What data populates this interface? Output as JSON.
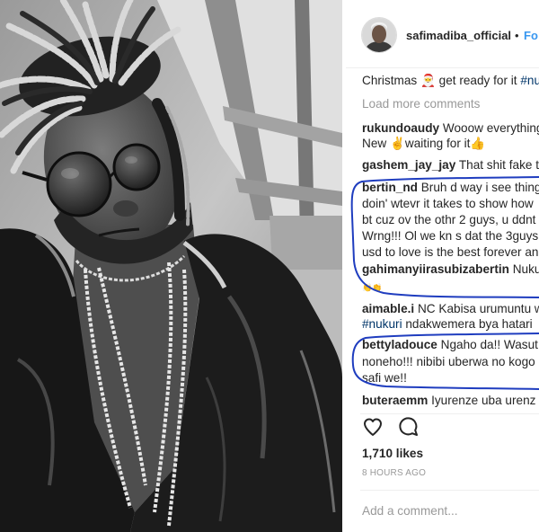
{
  "header": {
    "username": "safimadiba_official",
    "separator": "•",
    "follow_label": "Fo",
    "avatar_icon": "profile-avatar"
  },
  "caption": {
    "text": "Christmas 🎅 get ready for it ",
    "hashtag": "#nuku"
  },
  "load_more_label": "Load more comments",
  "comments": [
    {
      "username": "rukundoaudy",
      "lines": [
        "Wooow everything",
        "New ✌waiting for it👍"
      ]
    },
    {
      "username": "gashem_jay_jay",
      "lines": [
        "That shit fake th"
      ]
    },
    {
      "username": "bertin_nd",
      "lines": [
        "Bruh d way i see thing",
        "doin' wtevr it takes to show how",
        "bt cuz ov the othr 2 guys, u ddnt",
        "Wrng!!! Ol we kn s dat the 3guys",
        "usd to love is the best forever an"
      ]
    },
    {
      "username": "gahimanyiirasubizabertin",
      "lines": [
        "Nukuri",
        "👏👏"
      ]
    },
    {
      "username": "aimable.i",
      "lines": [
        "NC Kabisa urumuntu w",
        "#nukuri",
        " ndakwemera bya hatari"
      ]
    },
    {
      "username": "bettyladouce",
      "lines": [
        "Ngaho da!! Wasut",
        "noneho!!! nibibi uberwa no kogo",
        "safi we!!"
      ]
    },
    {
      "username": "buteraemm",
      "lines": [
        "Iyurenze uba urenz"
      ]
    }
  ],
  "actions": {
    "like_icon": "heart-outline-icon",
    "comment_icon": "speech-bubble-icon"
  },
  "likes": "1,710 likes",
  "timestamp": "8 HOURS AGO",
  "add_comment": {
    "placeholder": "Add a comment..."
  },
  "colors": {
    "text": "#262626",
    "muted": "#999999",
    "hashtag": "#003569",
    "follow": "#3897f0",
    "annotation_ink": "#1f3dbf",
    "divider": "#efefef"
  }
}
